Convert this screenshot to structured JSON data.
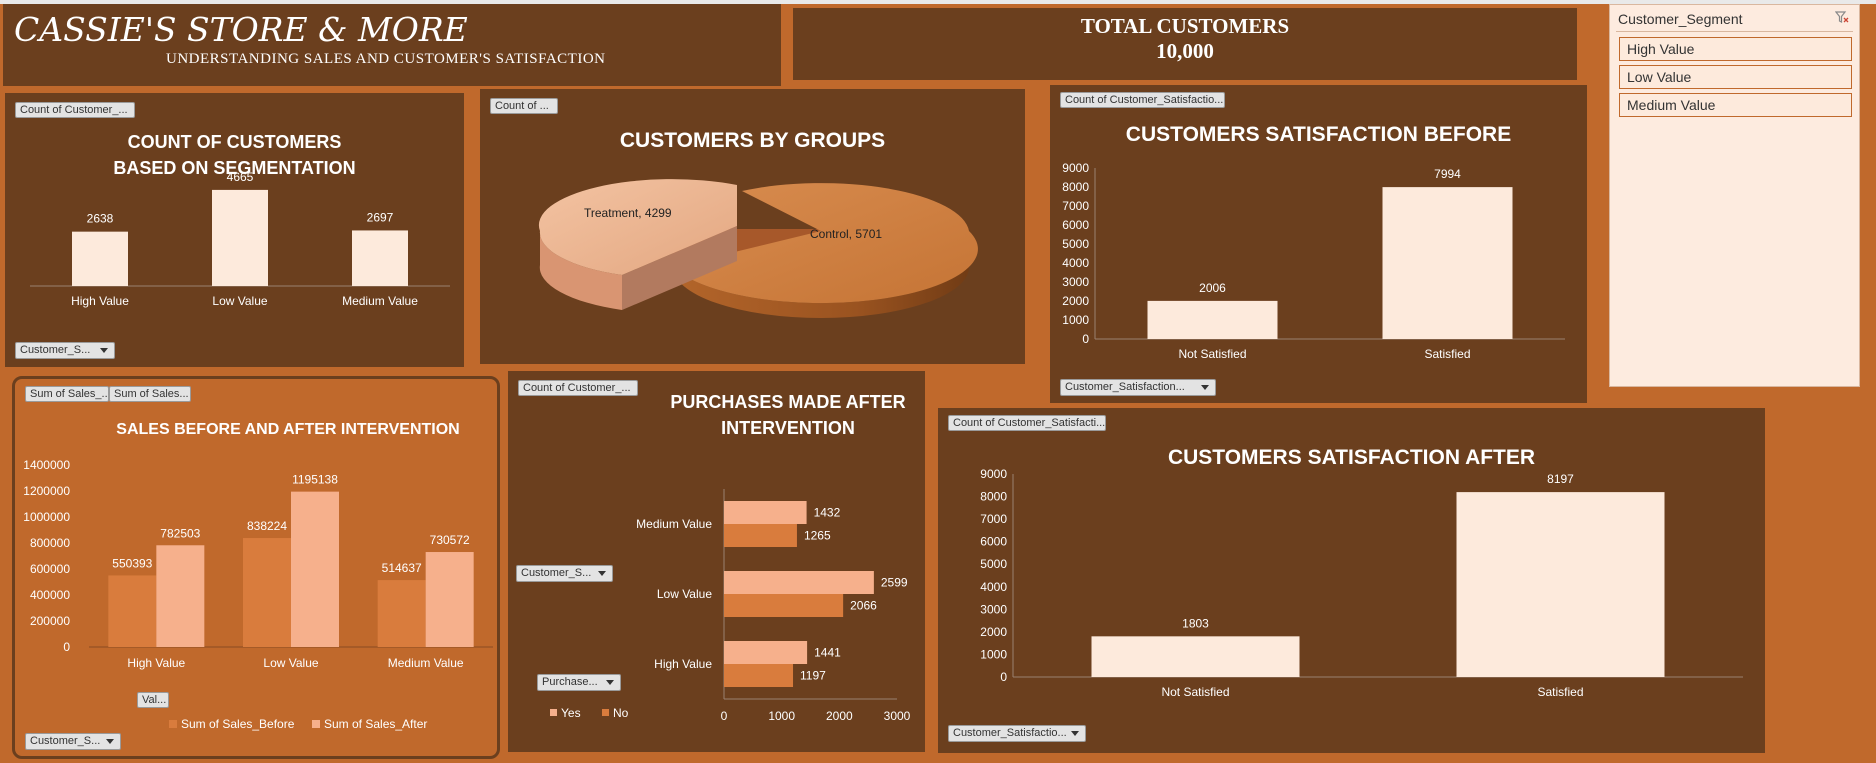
{
  "header": {
    "store_name": "CASSIE'S STORE & MORE",
    "subtitle": "UNDERSTANDING SALES AND CUSTOMER'S SATISFACTION"
  },
  "total": {
    "label": "TOTAL CUSTOMERS",
    "value": "10,000"
  },
  "slicer": {
    "title": "Customer_Segment",
    "clear_icon": "clear-filter-icon",
    "items": [
      "High Value",
      "Low Value",
      "Medium Value"
    ]
  },
  "colors": {
    "background": "#c0692c",
    "panel": "#6b3f1e",
    "bar_light": "#fdeadc",
    "peach": "#f6b08c",
    "orange": "#d97c3d"
  },
  "buttons": {
    "segmentation_value": "Count of Customer_...",
    "segmentation_axis": "Customer_S...",
    "groups_value": "Count of ...",
    "sat_before_value": "Count of Customer_Satisfactio...",
    "sat_before_axis": "Customer_Satisfaction...",
    "sales_value_1": "Sum of Sales_...",
    "sales_value_2": "Sum of Sales...",
    "sales_values": "Val...",
    "sales_axis": "Customer_S...",
    "purchases_value": "Count of Customer_...",
    "purchases_axis": "Customer_S...",
    "purchases_legend_filter": "Purchase...",
    "sat_after_value": "Count of Customer_Satisfacti...",
    "sat_after_axis": "Customer_Satisfactio..."
  },
  "chart_data": [
    {
      "id": "segmentation",
      "type": "bar",
      "title_line1": "COUNT OF CUSTOMERS",
      "title_line2": "BASED ON SEGMENTATION",
      "categories": [
        "High Value",
        "Low Value",
        "Medium Value"
      ],
      "values": [
        2638,
        4665,
        2697
      ],
      "labels": [
        "2638",
        "4665",
        "2697"
      ],
      "ylim": [
        0,
        5000
      ]
    },
    {
      "id": "groups",
      "type": "pie",
      "title": "CUSTOMERS BY GROUPS",
      "labels": [
        "Treatment,  4299",
        "Control, 5701"
      ],
      "slices": [
        {
          "name": "Treatment",
          "value": 4299
        },
        {
          "name": "Control",
          "value": 5701
        }
      ]
    },
    {
      "id": "sat_before",
      "type": "bar",
      "title": "CUSTOMERS SATISFACTION BEFORE",
      "categories": [
        "Not Satisfied",
        "Satisfied"
      ],
      "values": [
        2006,
        7994
      ],
      "labels": [
        "2006",
        "7994"
      ],
      "yticks": [
        "0",
        "1000",
        "2000",
        "3000",
        "4000",
        "5000",
        "6000",
        "7000",
        "8000",
        "9000"
      ],
      "ylim": [
        0,
        9000
      ]
    },
    {
      "id": "sales",
      "type": "bar",
      "title": "SALES BEFORE AND AFTER INTERVENTION",
      "categories": [
        "High Value",
        "Low Value",
        "Medium Value"
      ],
      "series": [
        {
          "name": "Sum of Sales_Before",
          "values": [
            550393,
            838224,
            514637
          ],
          "labels": [
            "550393",
            "838224",
            "514637"
          ]
        },
        {
          "name": "Sum of Sales_After",
          "values": [
            782503,
            1195138,
            730572
          ],
          "labels": [
            "782503",
            "1195138",
            "730572"
          ]
        }
      ],
      "yticks": [
        "0",
        "200000",
        "400000",
        "600000",
        "800000",
        "1000000",
        "1200000",
        "1400000"
      ],
      "ylim": [
        0,
        1400000
      ],
      "legend": "bottom"
    },
    {
      "id": "purchases",
      "type": "bar",
      "orientation": "horizontal",
      "title_line1": "PURCHASES MADE AFTER",
      "title_line2": "INTERVENTION",
      "categories": [
        "Medium Value",
        "Low Value",
        "High Value"
      ],
      "series": [
        {
          "name": "Yes",
          "values": [
            1432,
            2599,
            1441
          ],
          "labels": [
            "1432",
            "2599",
            "1441"
          ]
        },
        {
          "name": "No",
          "values": [
            1265,
            2066,
            1197
          ],
          "labels": [
            "1265",
            "2066",
            "1197"
          ]
        }
      ],
      "xticks": [
        "0",
        "1000",
        "2000",
        "3000"
      ],
      "xlim": [
        0,
        3000
      ],
      "legend": "bottom-left"
    },
    {
      "id": "sat_after",
      "type": "bar",
      "title": "CUSTOMERS SATISFACTION AFTER",
      "categories": [
        "Not Satisfied",
        "Satisfied"
      ],
      "values": [
        1803,
        8197
      ],
      "labels": [
        "1803",
        "8197"
      ],
      "yticks": [
        "0",
        "1000",
        "2000",
        "3000",
        "4000",
        "5000",
        "6000",
        "7000",
        "8000",
        "9000"
      ],
      "ylim": [
        0,
        9000
      ]
    }
  ]
}
